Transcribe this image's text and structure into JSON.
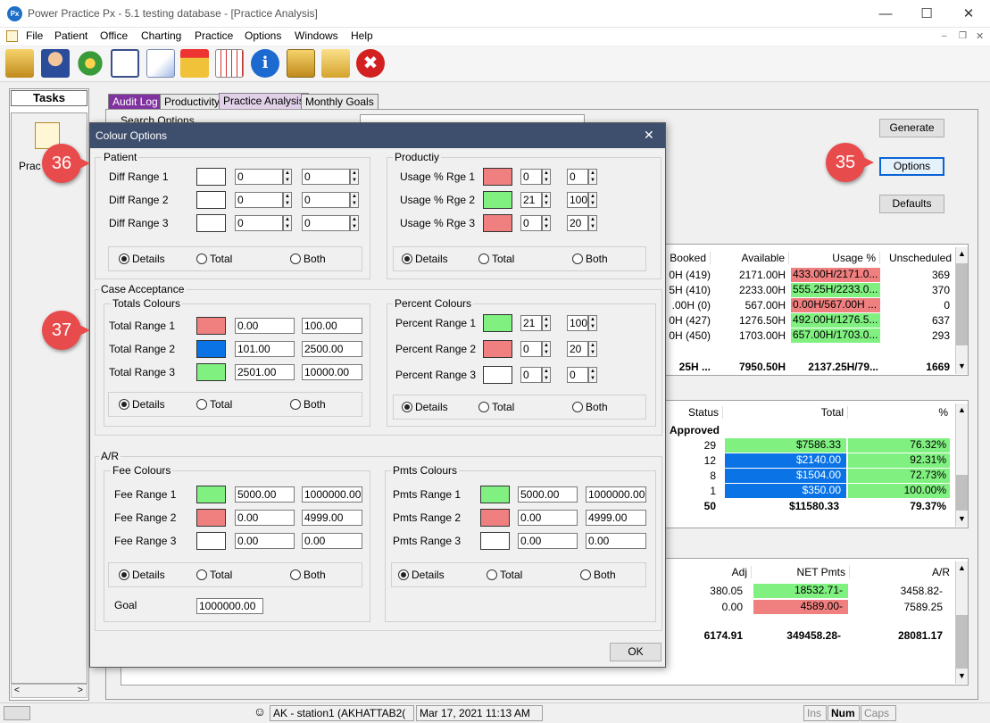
{
  "window": {
    "app_icon": "Px",
    "title": "Power Practice Px - 5.1 testing database - [Practice Analysis]"
  },
  "menu": [
    "File",
    "Patient",
    "Office",
    "Charting",
    "Practice",
    "Options",
    "Windows",
    "Help"
  ],
  "toolbar_icons": [
    "open-folder-icon",
    "patients-icon",
    "money-icon",
    "book-icon",
    "chart-icon",
    "gift-box-icon",
    "calendar-icon",
    "info-icon",
    "clipboard-icon",
    "folder-icon",
    "close-x-icon"
  ],
  "tasks": {
    "header": "Tasks",
    "item_label": "Prac"
  },
  "tabs": [
    "Audit Log",
    "Productivity",
    "Practice Analysis",
    "Monthly Goals"
  ],
  "search_options_label": "Search Options",
  "buttons": {
    "generate": "Generate",
    "options": "Options",
    "defaults": "Defaults"
  },
  "callouts": {
    "c35": "35",
    "c36": "36",
    "c37": "37"
  },
  "grid1": {
    "headers": [
      "Booked",
      "Available",
      "Usage %",
      "Unscheduled"
    ],
    "rows": [
      [
        "0H (419)",
        "2171.00H",
        "433.00H/2171.0...",
        "369"
      ],
      [
        "5H (410)",
        "2233.00H",
        "555.25H/2233.0...",
        "370"
      ],
      [
        ".00H (0)",
        "567.00H",
        "0.00H/567.00H ...",
        "0"
      ],
      [
        "0H (427)",
        "1276.50H",
        "492.00H/1276.5...",
        "637"
      ],
      [
        "0H (450)",
        "1703.00H",
        "657.00H/1703.0...",
        "293"
      ]
    ],
    "usage_colors": [
      "#f08080",
      "#80f080",
      "#f08080",
      "#80f080",
      "#80f080"
    ],
    "total": [
      "25H ...",
      "7950.50H",
      "2137.25H/79...",
      "1669"
    ]
  },
  "grid2": {
    "headers": [
      "Status",
      "Total",
      "%"
    ],
    "status_title": "Approved",
    "rows": [
      [
        "29",
        "$7586.33",
        "76.32%"
      ],
      [
        "12",
        "$2140.00",
        "92.31%"
      ],
      [
        "8",
        "$1504.00",
        "72.73%"
      ],
      [
        "1",
        "$350.00",
        "100.00%"
      ]
    ],
    "total_colors": [
      "#80f080",
      "#0a74e6",
      "#0a74e6",
      "#0a74e6"
    ],
    "pct_colors": [
      "#80f080",
      "#80f080",
      "#80f080",
      "#80f080"
    ],
    "total": [
      "50",
      "$11580.33",
      "79.37%"
    ]
  },
  "grid3": {
    "headers": [
      "Adj",
      "NET Pmts",
      "A/R"
    ],
    "rows": [
      [
        "380.05",
        "18532.71-",
        "3458.82-"
      ],
      [
        "0.00",
        "4589.00-",
        "7589.25"
      ]
    ],
    "net_colors": [
      "#80f080",
      "#f08080"
    ],
    "total": [
      "6174.91",
      "349458.28-",
      "28081.17"
    ]
  },
  "dialog": {
    "title": "Colour Options",
    "close": "✕",
    "ok": "OK",
    "patient": {
      "label": "Patient",
      "rows": [
        {
          "label": "Diff Range 1",
          "color": "#ffffff",
          "v1": "0",
          "v2": "0"
        },
        {
          "label": "Diff Range 2",
          "color": "#ffffff",
          "v1": "0",
          "v2": "0"
        },
        {
          "label": "Diff Range 3",
          "color": "#ffffff",
          "v1": "0",
          "v2": "0"
        }
      ]
    },
    "productivity": {
      "label": "Productiy",
      "rows": [
        {
          "label": "Usage % Rge 1",
          "color": "#f08080",
          "v1": "0",
          "v2": "0"
        },
        {
          "label": "Usage % Rge 2",
          "color": "#80f080",
          "v1": "21",
          "v2": "100"
        },
        {
          "label": "Usage % Rge 3",
          "color": "#f08080",
          "v1": "0",
          "v2": "20"
        }
      ]
    },
    "case_acceptance": {
      "label": "Case Acceptance",
      "totals_label": "Totals Colours",
      "totals": [
        {
          "label": "Total Range 1",
          "color": "#f08080",
          "v1": "0.00",
          "v2": "100.00"
        },
        {
          "label": "Total Range 2",
          "color": "#0a74e6",
          "v1": "101.00",
          "v2": "2500.00"
        },
        {
          "label": "Total Range 3",
          "color": "#80f080",
          "v1": "2501.00",
          "v2": "10000.00"
        }
      ],
      "percent_label": "Percent Colours",
      "percent": [
        {
          "label": "Percent Range 1",
          "color": "#80f080",
          "v1": "21",
          "v2": "100"
        },
        {
          "label": "Percent Range 2",
          "color": "#f08080",
          "v1": "0",
          "v2": "20"
        },
        {
          "label": "Percent Range 3",
          "color": "#ffffff",
          "v1": "0",
          "v2": "0"
        }
      ]
    },
    "ar": {
      "label": "A/R",
      "fee_label": "Fee Colours",
      "fee": [
        {
          "label": "Fee Range 1",
          "color": "#80f080",
          "v1": "5000.00",
          "v2": "1000000.00"
        },
        {
          "label": "Fee Range 2",
          "color": "#f08080",
          "v1": "0.00",
          "v2": "4999.00"
        },
        {
          "label": "Fee Range 3",
          "color": "#ffffff",
          "v1": "0.00",
          "v2": "0.00"
        }
      ],
      "pmts_label": "Pmts Colours",
      "pmts": [
        {
          "label": "Pmts Range 1",
          "color": "#80f080",
          "v1": "5000.00",
          "v2": "1000000.00"
        },
        {
          "label": "Pmts Range 2",
          "color": "#f08080",
          "v1": "0.00",
          "v2": "4999.00"
        },
        {
          "label": "Pmts Range 3",
          "color": "#ffffff",
          "v1": "0.00",
          "v2": "0.00"
        }
      ],
      "goal_label": "Goal",
      "goal_value": "1000000.00"
    },
    "radio": {
      "details": "Details",
      "total": "Total",
      "both": "Both"
    }
  },
  "statusbar": {
    "station": "AK - station1 (AKHATTAB2(",
    "datetime": "Mar 17, 2021 11:13 AM",
    "ins": "Ins",
    "num": "Num",
    "caps": "Caps"
  }
}
